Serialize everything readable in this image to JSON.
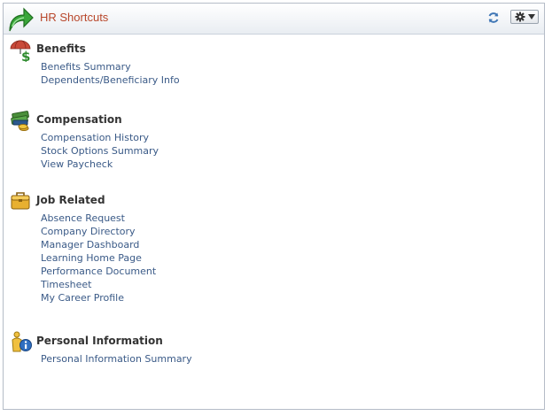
{
  "header": {
    "title": "HR Shortcuts",
    "icons": {
      "main": "green-arrow-icon",
      "refresh": "refresh-icon",
      "settings": "gear-icon",
      "menu": "caret-down-icon"
    }
  },
  "colors": {
    "title": "#b8472b",
    "link": "#3a5a87",
    "heading": "#333333"
  },
  "sections": [
    {
      "title": "Benefits",
      "icon": "benefits-umbrella-icon",
      "links": [
        "Benefits Summary",
        "Dependents/Beneficiary Info"
      ]
    },
    {
      "title": "Compensation",
      "icon": "money-stack-icon",
      "links": [
        "Compensation History",
        "Stock Options Summary",
        "View Paycheck"
      ]
    },
    {
      "title": "Job Related",
      "icon": "briefcase-icon",
      "links": [
        "Absence Request",
        "Company Directory",
        "Manager Dashboard",
        "Learning Home Page",
        "Performance Document",
        "Timesheet",
        "My Career Profile"
      ]
    },
    {
      "title": "Personal Information",
      "icon": "person-info-icon",
      "links": [
        "Personal Information Summary"
      ]
    }
  ]
}
